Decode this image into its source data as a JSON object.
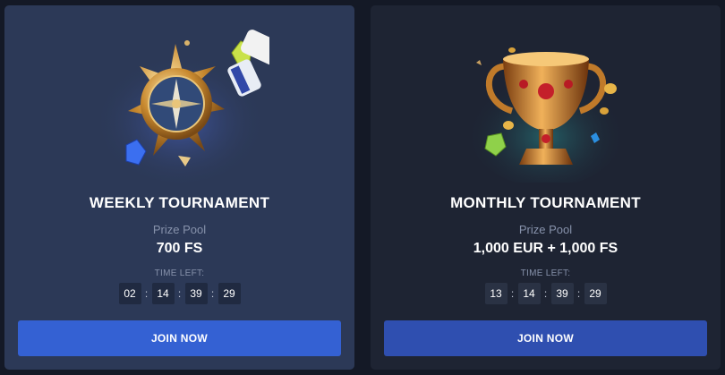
{
  "cards": [
    {
      "title": "WEEKLY TOURNAMENT",
      "prize_label": "Prize Pool",
      "prize_value": "700 FS",
      "time_label": "TIME LEFT:",
      "timer": [
        "02",
        "14",
        "39",
        "29"
      ],
      "separator": ":",
      "button_label": "JOIN NOW",
      "image_icon": "compass-icon"
    },
    {
      "title": "MONTHLY TOURNAMENT",
      "prize_label": "Prize Pool",
      "prize_value": "1,000 EUR + 1,000 FS",
      "time_label": "TIME LEFT:",
      "timer": [
        "13",
        "14",
        "39",
        "29"
      ],
      "separator": ":",
      "button_label": "JOIN NOW",
      "image_icon": "trophy-icon"
    }
  ],
  "colors": {
    "page_bg": "#141926",
    "weekly_card_bg": "#2c3957",
    "monthly_card_bg": "#1e2433",
    "weekly_button": "#3461d3",
    "monthly_button": "#2f4fb0"
  }
}
